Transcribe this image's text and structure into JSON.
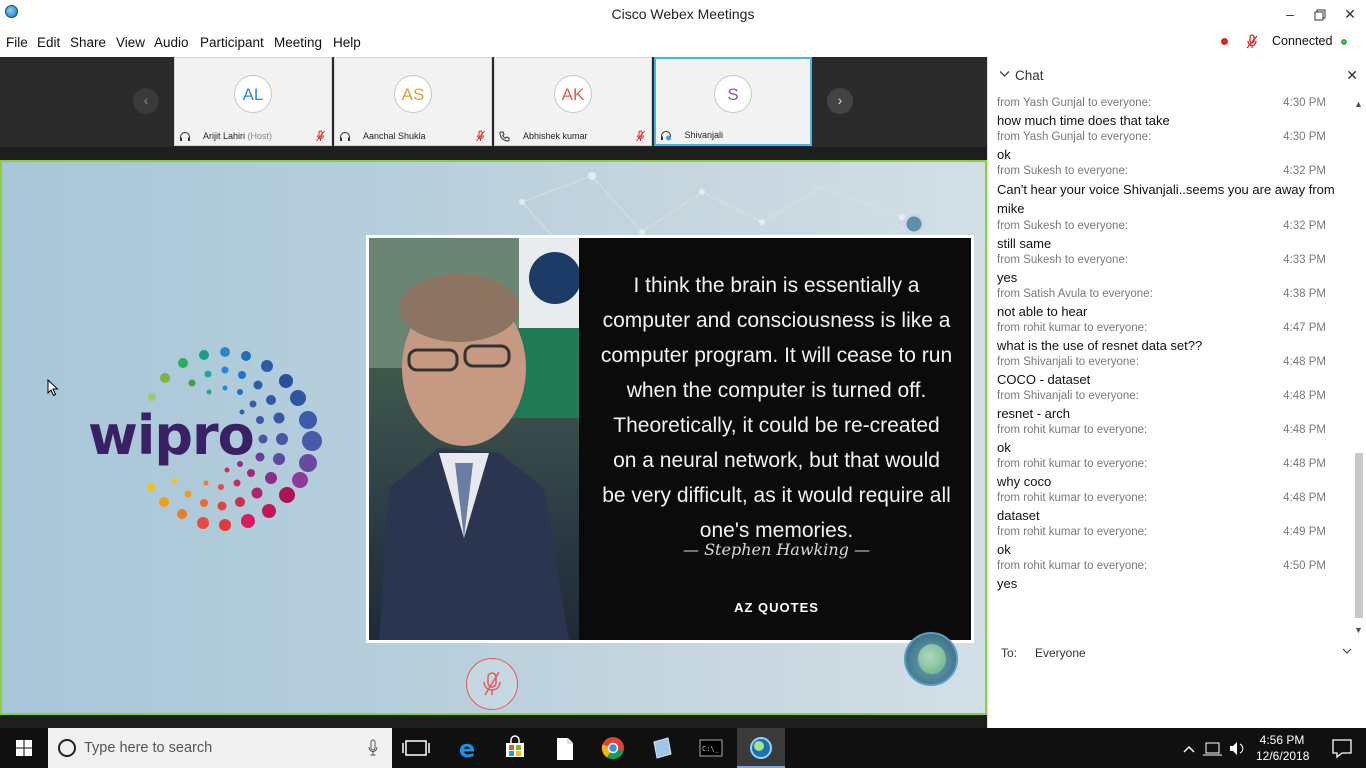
{
  "window": {
    "title": "Cisco Webex Meetings"
  },
  "menu": [
    "File",
    "Edit",
    "Share",
    "View",
    "Audio",
    "Participant",
    "Meeting",
    "Help"
  ],
  "status": {
    "connection": "Connected"
  },
  "participants": [
    {
      "initials": "AL",
      "name": "Arijit Lahiri",
      "role": "(Host)",
      "color": "#2a8fcf"
    },
    {
      "initials": "AS",
      "name": "Aanchal Shukla",
      "role": "",
      "color": "#e0a030"
    },
    {
      "initials": "AK",
      "name": "Abhishek kumar",
      "role": "",
      "color": "#d9614a"
    },
    {
      "initials": "S",
      "name": "Shivanjali",
      "role": "",
      "color": "#9a4fa8"
    }
  ],
  "shared": {
    "logo_text": "wipro",
    "quote": "I think the brain is essentially a computer and consciousness is like a computer program. It will cease to run when the computer is turned off. Theoretically, it could be re-created on a neural network, but that would be very difficult, as it would require all one's memories.",
    "author": "— Stephen Hawking —",
    "brand": "AZ QUOTES"
  },
  "chat": {
    "title": "Chat",
    "messages": [
      {
        "from": "from Yash Gunjal to everyone:",
        "time": "4:30 PM",
        "text": "how much time does that take"
      },
      {
        "from": "from Yash Gunjal to everyone:",
        "time": "4:30 PM",
        "text": "ok"
      },
      {
        "from": "from Sukesh to everyone:",
        "time": "4:32 PM",
        "text": "Can't hear your voice Shivanjali..seems you are away from mike"
      },
      {
        "from": "from Sukesh to everyone:",
        "time": "4:32 PM",
        "text": "still same"
      },
      {
        "from": "from Sukesh to everyone:",
        "time": "4:33 PM",
        "text": "yes"
      },
      {
        "from": "from Satish Avula to everyone:",
        "time": "4:38 PM",
        "text": "not able to hear"
      },
      {
        "from": "from rohit kumar to everyone:",
        "time": "4:47 PM",
        "text": "what is the use of resnet data  set??"
      },
      {
        "from": "from Shivanjali to everyone:",
        "time": "4:48 PM",
        "text": "COCO - dataset"
      },
      {
        "from": "from Shivanjali to everyone:",
        "time": "4:48 PM",
        "text": "resnet - arch"
      },
      {
        "from": "from rohit kumar to everyone:",
        "time": "4:48 PM",
        "text": "ok"
      },
      {
        "from": "from rohit kumar to everyone:",
        "time": "4:48 PM",
        "text": "why coco"
      },
      {
        "from": "from rohit kumar to everyone:",
        "time": "4:48 PM",
        "text": "dataset"
      },
      {
        "from": "from rohit kumar to everyone:",
        "time": "4:49 PM",
        "text": "ok"
      },
      {
        "from": "from rohit kumar to everyone:",
        "time": "4:50 PM",
        "text": "yes"
      }
    ],
    "to_label": "To:",
    "recipient": "Everyone"
  },
  "taskbar": {
    "search_placeholder": "Type here to search",
    "time": "4:56 PM",
    "date": "12/6/2018"
  }
}
